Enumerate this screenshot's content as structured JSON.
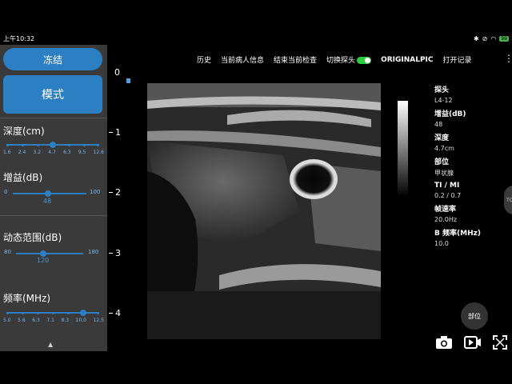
{
  "statusbar": {
    "time": "上午10:32",
    "battery": "99"
  },
  "sidebar": {
    "freeze_label": "冻结",
    "mode_label": "模式",
    "depth": {
      "label": "深度(cm)",
      "ticks": [
        "1.6",
        "2.4",
        "3.2",
        "4.7",
        "6.3",
        "9.5",
        "12.6"
      ],
      "value": 4.7
    },
    "gain": {
      "label": "增益(dB)",
      "min": "0",
      "max": "100",
      "value": "48"
    },
    "dynamic_range": {
      "label": "动态范围(dB)",
      "min": "80",
      "max": "180",
      "value": "120"
    },
    "frequency": {
      "label": "频率(MHz)",
      "ticks": [
        "5.0",
        "5.6",
        "6.3",
        "7.1",
        "8.3",
        "10.0",
        "12.5"
      ],
      "value": 10.0
    }
  },
  "ruler": {
    "ticks": [
      "0",
      "1",
      "2",
      "3",
      "4"
    ]
  },
  "topmenu": {
    "history": "历史",
    "patient_info": "当前病人信息",
    "end_exam": "结束当前检查",
    "switch_probe": "切换探头",
    "original_pic": "ORIGINALPIC",
    "open_records": "打开记录"
  },
  "info": {
    "probe_key": "探头",
    "probe_val": "L4-12",
    "gain_key": "增益(dB)",
    "gain_val": "48",
    "depth_key": "深度",
    "depth_val": "4.7cm",
    "site_key": "部位",
    "site_val": "甲状腺",
    "timi_key": "TI / MI",
    "timi_val": "0.2 / 0.7",
    "fps_key": "帧速率",
    "fps_val": "20.0Hz",
    "bfreq_key": "B 频率(MHz)",
    "bfreq_val": "10.0"
  },
  "side_chip_label": "TO",
  "part_button_label": "部位",
  "colors": {
    "accent": "#2d7fc4",
    "panel": "#3a3a3a",
    "toggle": "#2ecc40"
  }
}
